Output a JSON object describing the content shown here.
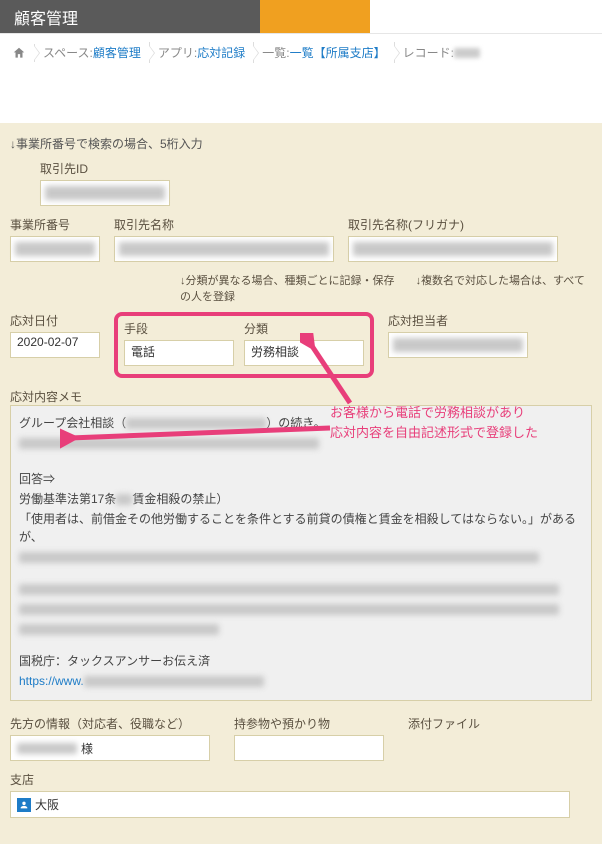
{
  "header": {
    "title": "顧客管理"
  },
  "breadcrumb": {
    "space_label": "スペース:",
    "space_link": "顧客管理",
    "app_label": "アプリ:",
    "app_link": "応対記録",
    "list_label": "一覧:",
    "list_link": "一覧【所属支店】",
    "record_label": "レコード:"
  },
  "form": {
    "search_note": "↓事業所番号で検索の場合、5桁入力",
    "partner_id_label": "取引先ID",
    "office_no_label": "事業所番号",
    "partner_name_label": "取引先名称",
    "partner_kana_label": "取引先名称(フリガナ)",
    "helper_1": "↓分類が異なる場合、種類ごとに記録・保存",
    "helper_2": "↓複数名で対応した場合は、すべての人を登録",
    "date_label": "応対日付",
    "date_value": "2020-02-07",
    "method_label": "手段",
    "method_value": "電話",
    "category_label": "分類",
    "category_value": "労務相談",
    "person_label": "応対担当者",
    "memo_label": "応対内容メモ",
    "memo": {
      "line1_a": "グループ会社相談（",
      "line1_b": "）の続き。",
      "answer_label": "回答⇒",
      "law_a": "労働基準法第17条",
      "law_b": "賃金相殺の禁止）",
      "quote": "「使用者は、前借金その他労働することを条件とする前貸の債権と賃金を相殺してはならない。」があるが、",
      "tax_office": "国税庁：タックスアンサーお伝え済",
      "link_prefix": "https://www."
    },
    "other_info_label": "先方の情報（対応者、役職など）",
    "other_info_suffix": "様",
    "belongings_label": "持参物や預かり物",
    "attachment_label": "添付ファイル",
    "branch_label": "支店",
    "branch_value": "大阪"
  },
  "annotation": {
    "line1": "お客様から電話で労務相談があり",
    "line2": "応対内容を自由記述形式で登録した"
  }
}
